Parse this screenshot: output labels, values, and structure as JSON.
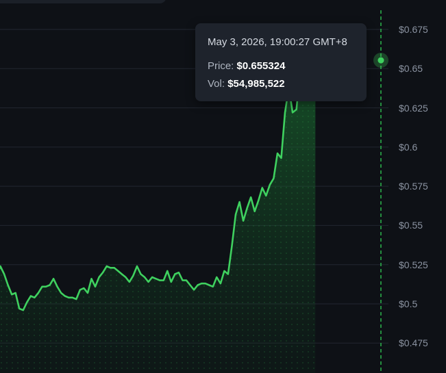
{
  "colors": {
    "background": "#0e1116",
    "line": "#3fd15f",
    "grid": "#222731",
    "crosshair": "#2bb84d",
    "tick_text": "#8b93a1"
  },
  "tooltip": {
    "time": "May 3, 2026, 19:00:27 GMT+8",
    "price_label": "Price:",
    "price_value": "$0.655324",
    "vol_label": "Vol:",
    "vol_value": "$54,985,522"
  },
  "chart_data": {
    "type": "area",
    "title": "",
    "xlabel": "",
    "ylabel": "",
    "ylim": [
      0.466,
      0.685
    ],
    "yticks": [
      0.475,
      0.5,
      0.525,
      0.55,
      0.575,
      0.6,
      0.625,
      0.65,
      0.675
    ],
    "ytick_labels": [
      "$0.475",
      "$0.5",
      "$0.525",
      "$0.55",
      "$0.575",
      "$0.6",
      "$0.625",
      "$0.65",
      "$0.675"
    ],
    "grid": true,
    "highlight_index": 109,
    "series": [
      {
        "values": [
          0.518,
          0.524,
          0.519,
          0.512,
          0.506,
          0.507,
          0.497,
          0.496,
          0.501,
          0.505,
          0.504,
          0.507,
          0.511,
          0.511,
          0.512,
          0.516,
          0.511,
          0.507,
          0.505,
          0.504,
          0.504,
          0.503,
          0.509,
          0.51,
          0.507,
          0.516,
          0.511,
          0.517,
          0.52,
          0.524,
          0.523,
          0.523,
          0.521,
          0.519,
          0.517,
          0.514,
          0.518,
          0.524,
          0.519,
          0.517,
          0.514,
          0.517,
          0.516,
          0.515,
          0.515,
          0.521,
          0.514,
          0.519,
          0.52,
          0.515,
          0.515,
          0.512,
          0.509,
          0.512,
          0.513,
          0.513,
          0.512,
          0.511,
          0.517,
          0.513,
          0.521,
          0.519,
          0.537,
          0.557,
          0.565,
          0.553,
          0.561,
          0.568,
          0.559,
          0.566,
          0.574,
          0.569,
          0.576,
          0.58,
          0.596,
          0.593,
          0.622,
          0.638,
          0.622,
          0.624,
          0.649,
          0.63,
          0.655,
          0.647,
          0.656
        ]
      }
    ],
    "x_positions_note": ""
  }
}
